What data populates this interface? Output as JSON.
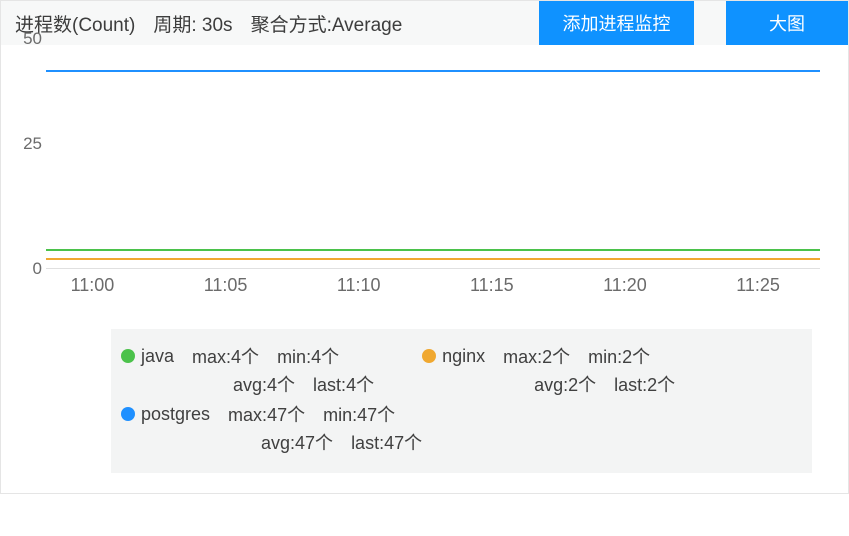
{
  "header": {
    "title": "进程数(Count)",
    "period_label": "周期: 30s",
    "agg_label": "聚合方式:Average",
    "btn_add": "添加进程监控",
    "btn_big": "大图"
  },
  "chart_data": {
    "type": "line",
    "ylabel": "",
    "xlabel": "",
    "ylim": [
      0,
      50
    ],
    "y_ticks": [
      0,
      25,
      50
    ],
    "x_ticks": [
      "11:00",
      "11:05",
      "11:10",
      "11:15",
      "11:20",
      "11:25"
    ],
    "series": [
      {
        "name": "java",
        "color": "#4bc24b",
        "max": "4个",
        "min": "4个",
        "avg": "4个",
        "last": "4个",
        "value": 4
      },
      {
        "name": "nginx",
        "color": "#f0a830",
        "max": "2个",
        "min": "2个",
        "avg": "2个",
        "last": "2个",
        "value": 2
      },
      {
        "name": "postgres",
        "color": "#1f90ff",
        "max": "47个",
        "min": "47个",
        "avg": "47个",
        "last": "47个",
        "value": 47
      }
    ]
  },
  "legend_labels": {
    "max": "max:",
    "min": "min:",
    "avg": "avg:",
    "last": "last:"
  }
}
